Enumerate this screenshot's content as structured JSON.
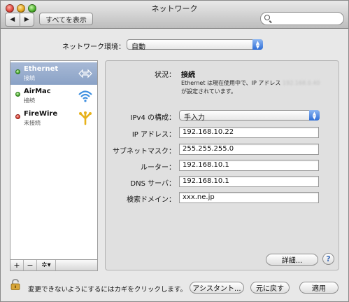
{
  "window": {
    "title": "ネットワーク"
  },
  "toolbar": {
    "back_icon": "◀",
    "forward_icon": "▶",
    "show_all_label": "すべてを表示",
    "search_placeholder": ""
  },
  "location": {
    "label": "ネットワーク環境：",
    "value": "自動"
  },
  "services": [
    {
      "name": "Ethernet",
      "status": "接続",
      "status_color": "green",
      "icon": "ethernet-icon",
      "selected": true
    },
    {
      "name": "AirMac",
      "status": "接続",
      "status_color": "green",
      "icon": "wifi-icon",
      "selected": false
    },
    {
      "name": "FireWire",
      "status": "未接続",
      "status_color": "red",
      "icon": "firewire-icon",
      "selected": false
    }
  ],
  "sidebar_buttons": {
    "add": "+",
    "remove": "−",
    "gear": "✲▾"
  },
  "detail": {
    "status_label": "状況：",
    "status_value": "接続",
    "status_desc_pre": "Ethernet は現在使用中で、IP アドレス",
    "status_desc_ip": "192.168.0.40",
    "status_desc_post": "が設定されています。",
    "ipv4_label": "IPv4 の構成：",
    "ipv4_value": "手入力",
    "ip_label": "IP アドレス：",
    "ip_value": "192.168.10.22",
    "subnet_label": "サブネットマスク：",
    "subnet_value": "255.255.255.0",
    "router_label": "ルーター：",
    "router_value": "192.168.10.1",
    "dns_label": "DNS サーバ：",
    "dns_value": "192.168.10.1",
    "search_domain_label": "検索ドメイン：",
    "search_domain_value": "xxx.ne.jp",
    "advanced_label": "詳細...",
    "help_label": "?"
  },
  "footer": {
    "lock_text": "変更できないようにするにはカギをクリックします。",
    "assistant_label": "アシスタント...",
    "revert_label": "元に戻す",
    "apply_label": "適用"
  }
}
